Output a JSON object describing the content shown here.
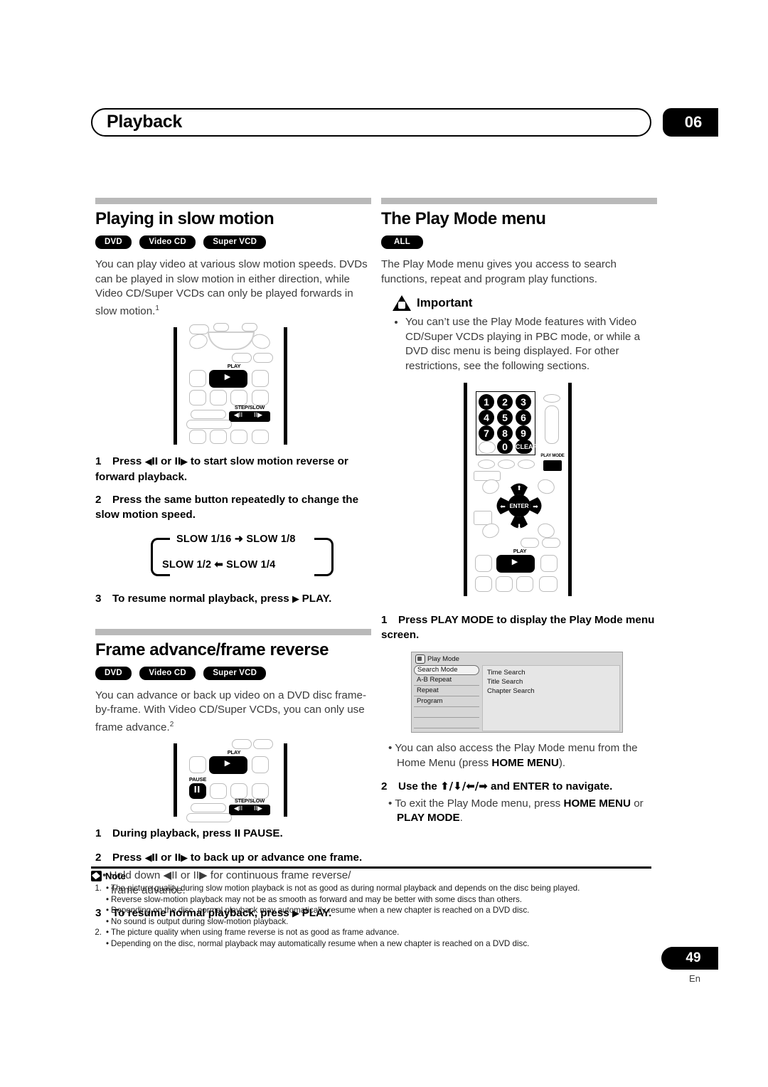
{
  "header": {
    "title": "Playback",
    "chapter": "06"
  },
  "footer": {
    "page_number": "49",
    "language": "En"
  },
  "left_column": {
    "section1": {
      "heading": "Playing in slow motion",
      "badges": [
        "DVD",
        "Video CD",
        "Super VCD"
      ],
      "intro": "You can play video at various slow motion speeds. DVDs can be played in slow motion in either direction, while Video CD/Super VCDs can only be played forwards in slow motion.",
      "intro_footnote": "1",
      "remote1": {
        "play_label": "PLAY",
        "play_glyph": "▶",
        "step_slow_label": "STEP/SLOW",
        "step_slow_left": "◀II",
        "step_slow_right": "II▶"
      },
      "steps": [
        {
          "num": "1",
          "text_before": "Press ",
          "icon_a": "◀II",
          "mid": " or ",
          "icon_b": "II▶",
          "text_after": " to start slow motion reverse or forward playback."
        },
        {
          "num": "2",
          "text_before": "Press the same button repeatedly to change the slow motion speed.",
          "icon_a": "",
          "mid": "",
          "icon_b": "",
          "text_after": ""
        },
        {
          "num": "3",
          "text_before": "To resume normal playback, press ",
          "icon_a": "▶",
          "mid": "",
          "icon_b": "",
          "text_after": " PLAY."
        }
      ],
      "cycle": {
        "row1": "SLOW 1/16  ➜  SLOW 1/8",
        "row2": "SLOW 1/2  ⬅  SLOW 1/4",
        "items": [
          "SLOW 1/16",
          "SLOW 1/8",
          "SLOW 1/4",
          "SLOW 1/2"
        ]
      }
    },
    "section2": {
      "heading": "Frame advance/frame reverse",
      "badges": [
        "DVD",
        "Video CD",
        "Super VCD"
      ],
      "intro": "You can advance or back up video on a DVD disc frame-by-frame. With Video CD/Super VCDs, you can only use frame advance.",
      "intro_footnote": "2",
      "remote2": {
        "play_label": "PLAY",
        "play_glyph": "▶",
        "pause_label": "PAUSE",
        "pause_glyph": "II",
        "step_slow_label": "STEP/SLOW",
        "step_slow_left": "◀II",
        "step_slow_right": "II▶"
      },
      "steps": [
        {
          "num": "1",
          "text_before": "During playback, press ",
          "icon_a": "II",
          "mid": "",
          "icon_b": "",
          "text_after": " PAUSE."
        },
        {
          "num": "2",
          "text_before": "Press ",
          "icon_a": "◀II",
          "mid": " or ",
          "icon_b": "II▶",
          "text_after": " to back up or advance one frame."
        },
        {
          "num": "3",
          "text_before": "To resume normal playback, press ",
          "icon_a": "▶",
          "mid": "",
          "icon_b": "",
          "text_after": " PLAY."
        }
      ],
      "sub_bullet": "Hold down ◀II or II▶ for continuous frame reverse/ frame advance."
    }
  },
  "right_column": {
    "heading": "The Play Mode menu",
    "badges": [
      "ALL"
    ],
    "intro": "The Play Mode menu gives you access to search functions, repeat and program play functions.",
    "important": {
      "title": "Important",
      "bullets": [
        "You can’t use the Play Mode features with Video CD/Super VCDs playing in PBC mode, or while a DVD disc menu is being displayed. For other restrictions, see the following sections."
      ]
    },
    "remote3": {
      "number_keys": [
        "1",
        "2",
        "3",
        "4",
        "5",
        "6",
        "7",
        "8",
        "9",
        "0"
      ],
      "clear_label": "CLEAR",
      "play_mode_label": "PLAY MODE",
      "enter_label": "ENTER",
      "up_glyph": "⬆",
      "down_glyph": "⬇",
      "left_glyph": "⬅",
      "right_glyph": "➡",
      "play_label": "PLAY",
      "play_glyph": "▶"
    },
    "steps": [
      {
        "num": "1",
        "text": "Press PLAY MODE to display the Play Mode menu screen."
      },
      {
        "num": "2",
        "text_a": "Use the ",
        "arrows": "⬆/⬇/⬅/➡",
        "text_b": " and ENTER to navigate."
      }
    ],
    "bullets": [
      {
        "plain_a": "You can also access the Play Mode menu from the Home Menu (press ",
        "bold": "HOME MENU",
        "plain_b": ")."
      },
      {
        "plain_a": "To exit the Play Mode menu, press ",
        "bold": "HOME MENU",
        "plain_b": " or ",
        "bold2": "PLAY MODE",
        "plain_c": "."
      }
    ],
    "osd": {
      "title": "Play Mode",
      "left_items": [
        "Search Mode",
        "A-B Repeat",
        "Repeat",
        "Program"
      ],
      "right_items": [
        "Time Search",
        "Title Search",
        "Chapter Search"
      ],
      "selected": "Search Mode"
    }
  },
  "notes": {
    "title": "Note",
    "groups": [
      {
        "index": "1.",
        "items": [
          "The picture quality during slow motion playback is not as good as during normal playback and depends on the disc being played.",
          "Reverse slow-motion playback may not be as smooth as forward and may be better with some discs than others.",
          "Depending on the disc, normal playback may automatically resume when a new chapter is reached on a DVD disc.",
          "No sound is output during slow-motion playback."
        ]
      },
      {
        "index": "2.",
        "items": [
          "The picture quality when using frame reverse is not as good as frame advance.",
          "Depending on the disc, normal playback may automatically resume when a new chapter is reached on a DVD disc."
        ]
      }
    ]
  }
}
